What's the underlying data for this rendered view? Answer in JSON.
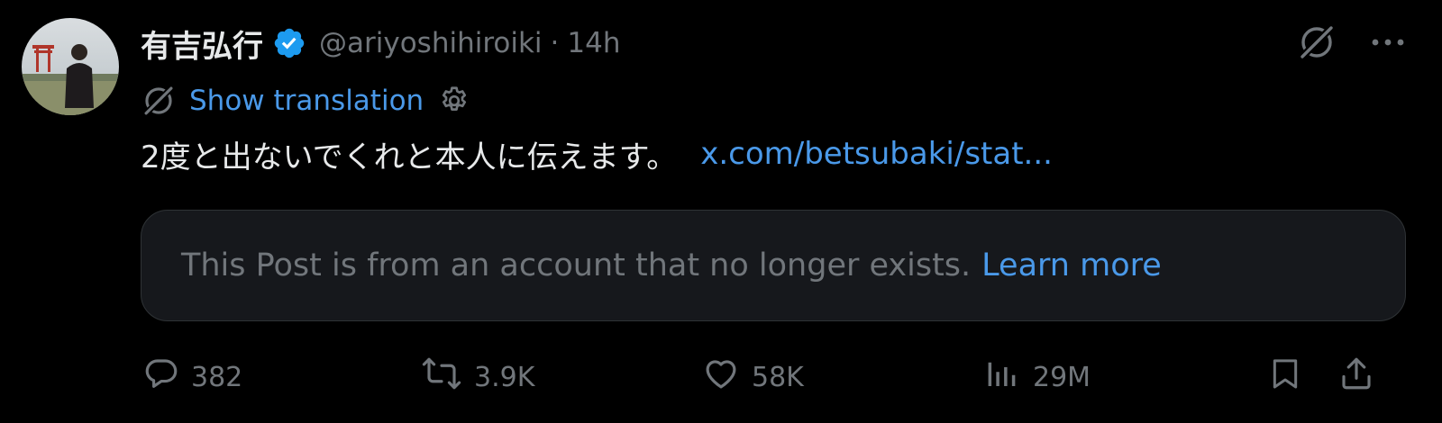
{
  "author": {
    "display_name": "有吉弘行",
    "handle": "@ariyoshihiroiki",
    "separator": "·",
    "time": "14h",
    "verified": true
  },
  "translation": {
    "label": "Show translation"
  },
  "post": {
    "text": "2度と出ないでくれと本人に伝えます。",
    "link_text": "x.com/betsubaki/stat..."
  },
  "quoted_notice": {
    "text": "This Post is from an account that no longer exists.",
    "link_label": "Learn more"
  },
  "actions": {
    "replies": "382",
    "reposts": "3.9K",
    "likes": "58K",
    "views": "29M"
  },
  "colors": {
    "background": "#000000",
    "text": "#e7e9ea",
    "muted": "#71767b",
    "link": "#4a99e9",
    "verified": "#1d9bf0",
    "card_bg": "#16181c",
    "card_border": "#2f3336"
  },
  "icons": {
    "grok": "grok-icon",
    "more": "more-icon",
    "settings": "gear-icon",
    "reply": "reply-icon",
    "repost": "repost-icon",
    "like": "heart-icon",
    "views": "analytics-icon",
    "bookmark": "bookmark-icon",
    "share": "share-icon"
  }
}
